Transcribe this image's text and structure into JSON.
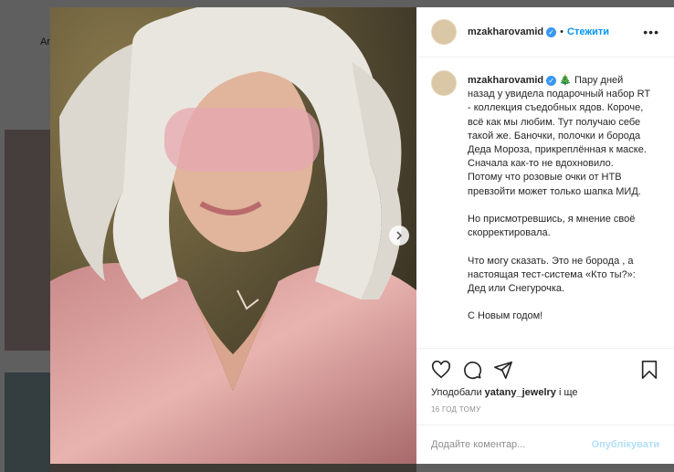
{
  "colors": {
    "accent": "#0095f6",
    "verified": "#3897f0",
    "publish_disabled": "#b2dffc"
  },
  "backdrop": {
    "partial_nav_text": "Ar"
  },
  "post": {
    "username": "mzakharovamid",
    "follow_label": "Стежити",
    "separator": "•",
    "more_label": "•••",
    "caption": " 🎄 Пару дней назад у увидела подарочный набор RT - коллекция съедобных ядов. Короче, всё как мы любим. Тут получаю себе такой же. Баночки, полочки и борода Деда Мороза, прикреплённая к маске. Сначала как-то не вдохновило. Потому что розовые очки от НТВ превзойти может только шапка МИД.\n\nНо присмотревшись, я мнение своё скорректировала.\n\nЧто могу сказать. Это не борода , а настоящая тест-система «Кто ты?»: Дед или Снегурочка.\n\nС Новым годом!",
    "likes_prefix": "Уподобали ",
    "likes_user": "yatany_jewelry",
    "likes_suffix": " і ще",
    "timestamp": "16 ГОД ТОМУ",
    "comment_placeholder": "Додайте коментар...",
    "publish_label": "Опублікувати"
  },
  "icons": [
    "chevron-right-icon",
    "heart-icon",
    "comment-icon",
    "share-icon",
    "bookmark-icon",
    "verified-icon"
  ]
}
